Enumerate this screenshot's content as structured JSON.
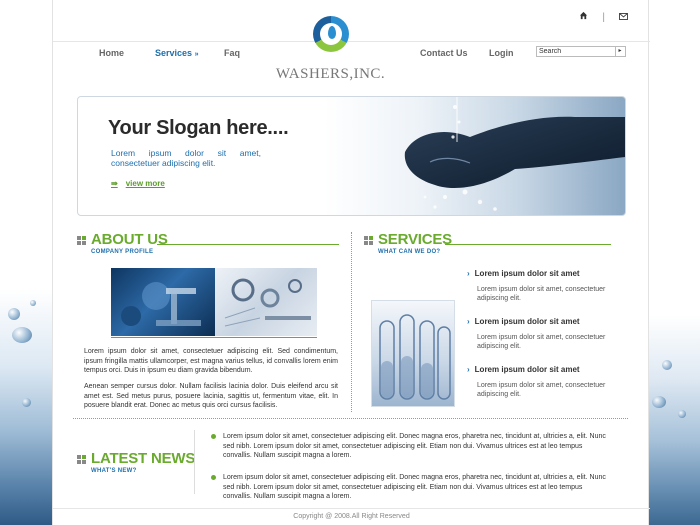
{
  "site": {
    "logo_text": "WASHERS,INC."
  },
  "top_icons": [
    "home-icon",
    "mail-icon"
  ],
  "nav_left": [
    {
      "label": "Home",
      "active": false
    },
    {
      "label": "Services",
      "active": true
    },
    {
      "label": "Faq",
      "active": false
    }
  ],
  "nav_right": [
    {
      "label": "Contact Us"
    },
    {
      "label": "Login"
    }
  ],
  "search": {
    "value": "Search"
  },
  "banner": {
    "slogan": "Your Slogan here....",
    "subtitle": "Lorem ipsum dolor sit amet, consectetuer adipiscing elit.",
    "cta": "view more"
  },
  "about": {
    "title": "ABOUT US",
    "subtitle": "COMPANY PROFILE",
    "para1": "Lorem ipsum dolor sit amet, consectetuer adipiscing elit. Sed condimentum, ipsum fringilla mattis ullamcorper, est magna varius tellus, id convallis lorem enim tempus orci. Duis in ipsum eu diam gravida bibendum.",
    "para2": "Aenean semper cursus dolor. Nullam facilisis lacinia dolor. Duis eleifend arcu sit amet est. Sed metus purus, posuere lacinia, sagittis ut, fermentum vitae, elit. In posuere blandit erat. Donec ac metus quis orci cursus facilisis."
  },
  "services": {
    "title": "SERVICES",
    "subtitle": "WHAT CAN WE DO?",
    "items": [
      {
        "title": "Lorem ipsum dolor sit amet",
        "desc": "Lorem ipsum dolor sit amet, consectetuer adipiscing elit."
      },
      {
        "title": "Lorem ipsum dolor sit amet",
        "desc": "Lorem ipsum dolor sit amet, consectetuer adipiscing elit."
      },
      {
        "title": "Lorem ipsum dolor sit amet",
        "desc": "Lorem ipsum dolor sit amet, consectetuer adipiscing elit."
      }
    ]
  },
  "news": {
    "title": "LATEST NEWS",
    "subtitle": "WHAT'S NEW?",
    "items": [
      "Lorem ipsum dolor sit amet, consectetuer adipiscing elit. Donec magna eros, pharetra nec, tincidunt at, ultricies a, elit. Nunc sed nibh. Lorem ipsum dolor sit amet, consectetuer adipiscing elit. Etiam non dui. Vivamus ultrices est at leo tempus convallis. Nullam suscipit magna a lorem.",
      "Lorem ipsum dolor sit amet, consectetuer adipiscing elit. Donec magna eros, pharetra nec, tincidunt at, ultricies a, elit. Nunc sed nibh. Lorem ipsum dolor sit amet, consectetuer adipiscing elit. Etiam non dui. Vivamus ultrices est at leo tempus convallis. Nullam suscipit magna a lorem."
    ]
  },
  "footer": {
    "copyright": "Copyright @ 2008.All Right Reserved"
  },
  "colors": {
    "accent_green": "#6aab2e",
    "accent_blue": "#1e6fae"
  }
}
